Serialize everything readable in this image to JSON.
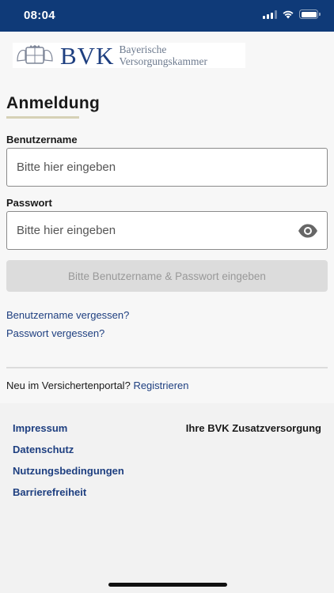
{
  "status_bar": {
    "time": "08:04",
    "icons": [
      "signal-icon",
      "wifi-icon",
      "battery-icon"
    ],
    "background_color": "#0f3a78"
  },
  "logo": {
    "acronym": "BVK",
    "line1": "Bayerische",
    "line2": "Versorgungskammer",
    "brand_color": "#1e3f80"
  },
  "login": {
    "title": "Anmeldung",
    "username_label": "Benutzername",
    "username_placeholder": "Bitte hier eingeben",
    "password_label": "Passwort",
    "password_placeholder": "Bitte hier eingeben",
    "password_toggle_icon": "eye-icon",
    "submit_label": "Bitte Benutzername & Passwort eingeben",
    "forgot_username": "Benutzername vergessen?",
    "forgot_password": "Passwort vergessen?",
    "new_user_text": "Neu im Versichertenportal?",
    "register_label": "Registrieren"
  },
  "footer": {
    "links": [
      "Impressum",
      "Datenschutz",
      "Nutzungsbedingungen",
      "Barrierefreiheit"
    ],
    "brand_text": "Ihre BVK Zusatzversorgung"
  }
}
